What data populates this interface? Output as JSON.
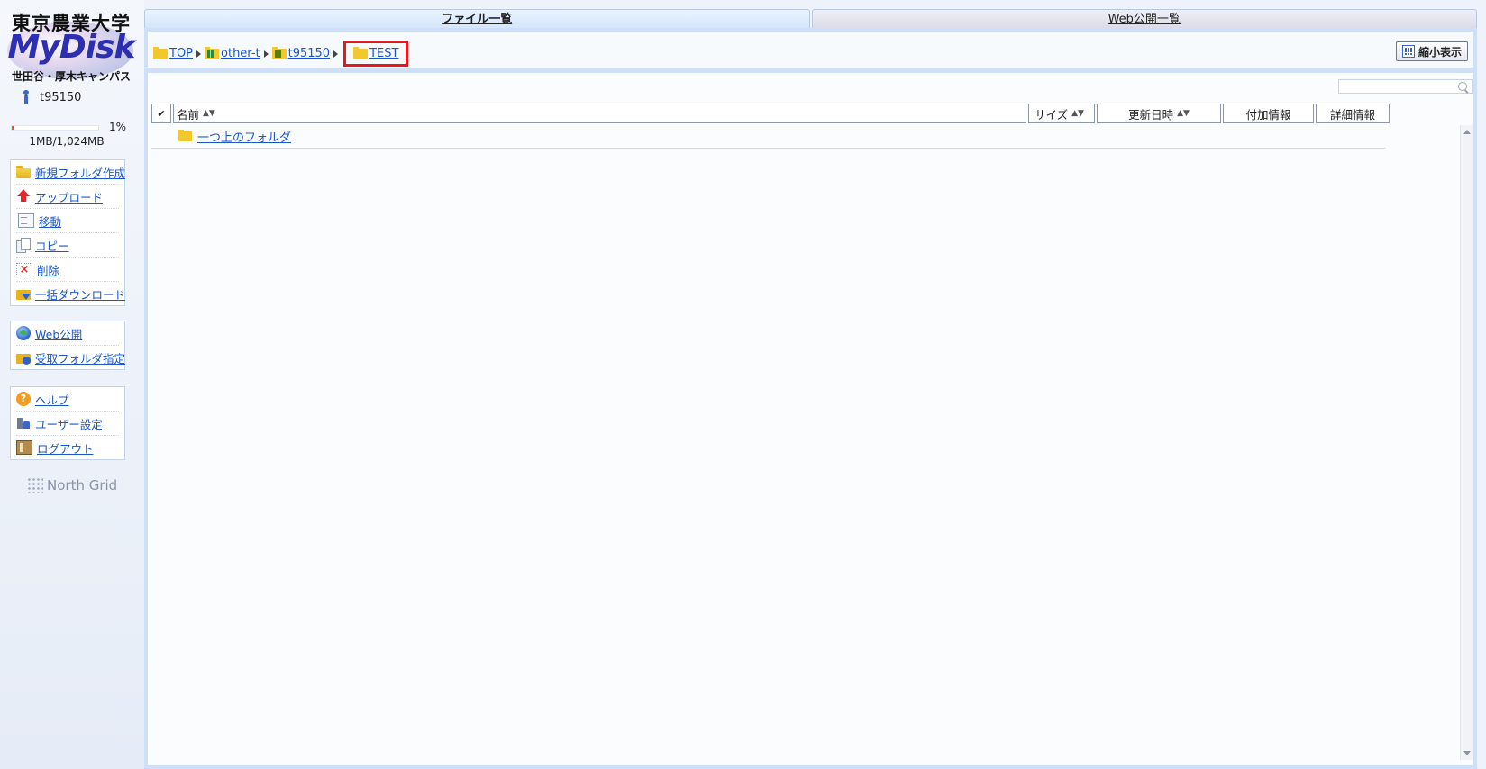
{
  "logo": {
    "line1": "東京農業大学",
    "line2": "MyDisk",
    "line3": "世田谷・厚木キャンパス"
  },
  "user": {
    "name": "t95150"
  },
  "quota": {
    "percent_label": "1%",
    "fraction": 0.01,
    "size_label": "1MB/1,024MB"
  },
  "menu1": [
    {
      "label": "新規フォルダ作成",
      "icon": "new-folder-icon"
    },
    {
      "label": "アップロード",
      "icon": "upload-icon"
    },
    {
      "label": "移動",
      "icon": "move-icon"
    },
    {
      "label": "コピー",
      "icon": "copy-icon"
    },
    {
      "label": "削除",
      "icon": "delete-icon"
    },
    {
      "label": "一括ダウンロード",
      "icon": "bulk-download-icon"
    }
  ],
  "menu2": [
    {
      "label": "Web公開",
      "icon": "globe-icon"
    },
    {
      "label": "受取フォルダ指定",
      "icon": "receive-folder-icon"
    }
  ],
  "menu3": [
    {
      "label": "ヘルプ",
      "icon": "help-icon"
    },
    {
      "label": "ユーザー設定",
      "icon": "user-settings-icon"
    },
    {
      "label": "ログアウト",
      "icon": "logout-icon"
    }
  ],
  "brand": "North Grid",
  "tabs": [
    {
      "label": "ファイル一覧",
      "active": true
    },
    {
      "label": "Web公開一覧",
      "active": false
    }
  ],
  "breadcrumb": [
    {
      "label": "TOP",
      "icon": "folder-icon"
    },
    {
      "label": "other-t",
      "icon": "shared-folder-icon"
    },
    {
      "label": "t95150",
      "icon": "shared-folder-icon"
    },
    {
      "label": "TEST",
      "icon": "folder-icon",
      "current": true
    }
  ],
  "toolbar": {
    "shrink_label": "縮小表示"
  },
  "search": {
    "value": "",
    "placeholder": ""
  },
  "columns": {
    "check": "✔",
    "name": "名前",
    "size": "サイズ",
    "date": "更新日時",
    "extra": "付加情報",
    "detail": "詳細情報",
    "sort_arrows": "▲▼"
  },
  "rows": [
    {
      "label": "一つ上のフォルダ",
      "icon": "folder-icon"
    }
  ],
  "colors": {
    "accent": "#1a56c8",
    "highlight": "#e8171d",
    "folder": "#f3c82e"
  }
}
